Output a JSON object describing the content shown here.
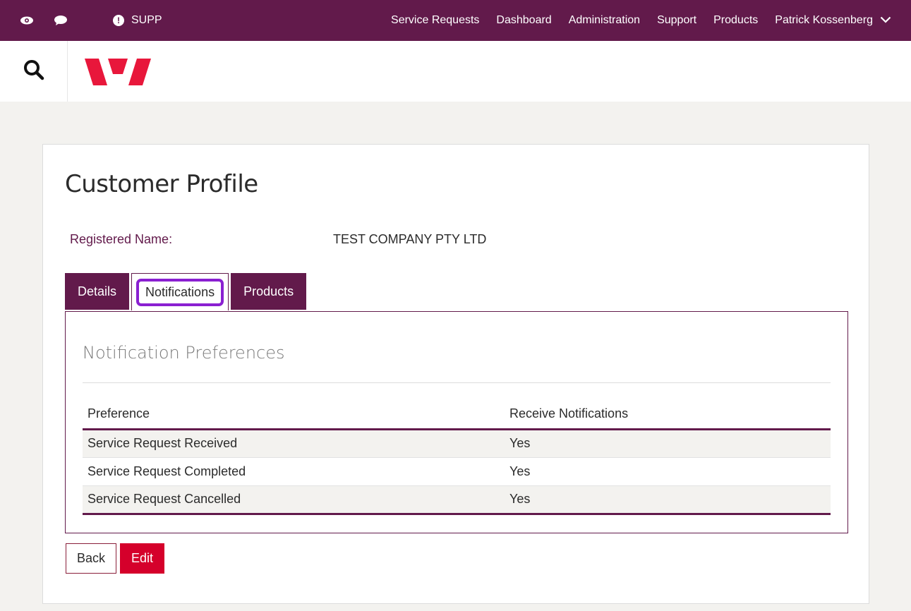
{
  "topbar": {
    "icons": [
      "eye-icon",
      "chat-icon"
    ],
    "alert_label": "SUPP",
    "nav": [
      "Service Requests",
      "Dashboard",
      "Administration",
      "Support",
      "Products"
    ],
    "user": "Patrick Kossenberg"
  },
  "colors": {
    "brand": "#621a4b",
    "accent": "#d5002b",
    "highlight": "#8a1fd1"
  },
  "page": {
    "title": "Customer Profile",
    "registered_name_label": "Registered Name:",
    "registered_name_value": "TEST COMPANY PTY LTD",
    "tabs": [
      {
        "label": "Details",
        "active": false
      },
      {
        "label": "Notifications",
        "active": true
      },
      {
        "label": "Products",
        "active": false
      }
    ]
  },
  "notifications": {
    "title": "Notification Preferences",
    "headers": [
      "Preference",
      "Receive Notifications"
    ],
    "rows": [
      [
        "Service Request Received",
        "Yes"
      ],
      [
        "Service Request Completed",
        "Yes"
      ],
      [
        "Service Request Cancelled",
        "Yes"
      ]
    ]
  },
  "buttons": {
    "back": "Back",
    "edit": "Edit"
  }
}
